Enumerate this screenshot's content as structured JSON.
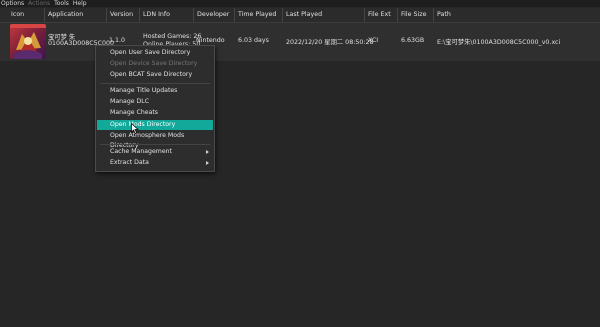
{
  "menubar": {
    "items": [
      {
        "label": "Options",
        "disabled": false
      },
      {
        "label": "Actions",
        "disabled": true
      },
      {
        "label": "Tools",
        "disabled": false
      },
      {
        "label": "Help",
        "disabled": false
      }
    ]
  },
  "columns": {
    "icon": "Icon",
    "application": "Application",
    "version": "Version",
    "ldn": "LDN Info",
    "developer": "Developer",
    "time_played": "Time Played",
    "last_played": "Last Played",
    "file_ext": "File Ext",
    "file_size": "File Size",
    "path": "Path"
  },
  "game": {
    "title": "宝可梦 朱",
    "title_id": "0100A3D008C5C000",
    "version": "1.1.0",
    "ldn_games": "Hosted Games: 26",
    "ldn_players": "Online Players: 50",
    "developer": "Nintendo",
    "time_played": "6.03 days",
    "last_played": "2022/12/20 星期二 08:50:28",
    "file_ext": "XCI",
    "file_size": "6.63GB",
    "path": "E:\\宝可梦朱\\0100A3D008C5C000_v0.xci"
  },
  "context_menu": {
    "items": [
      {
        "label": "Open User Save Directory",
        "disabled": false
      },
      {
        "label": "Open Device Save Directory",
        "disabled": true
      },
      {
        "label": "Open BCAT Save Directory",
        "disabled": false
      },
      {
        "label": "Manage Title Updates",
        "disabled": false
      },
      {
        "label": "Manage DLC",
        "disabled": false
      },
      {
        "label": "Manage Cheats",
        "disabled": false
      },
      {
        "label": "Open Mods Directory",
        "disabled": false,
        "highlighted": true
      },
      {
        "label": "Open Atmosphere Mods Directory",
        "disabled": false
      },
      {
        "label": "Cache Management",
        "disabled": false,
        "submenu": true
      },
      {
        "label": "Extract Data",
        "disabled": false,
        "submenu": true
      }
    ]
  },
  "colors": {
    "highlight": "#12a89a",
    "background": "#262626"
  }
}
